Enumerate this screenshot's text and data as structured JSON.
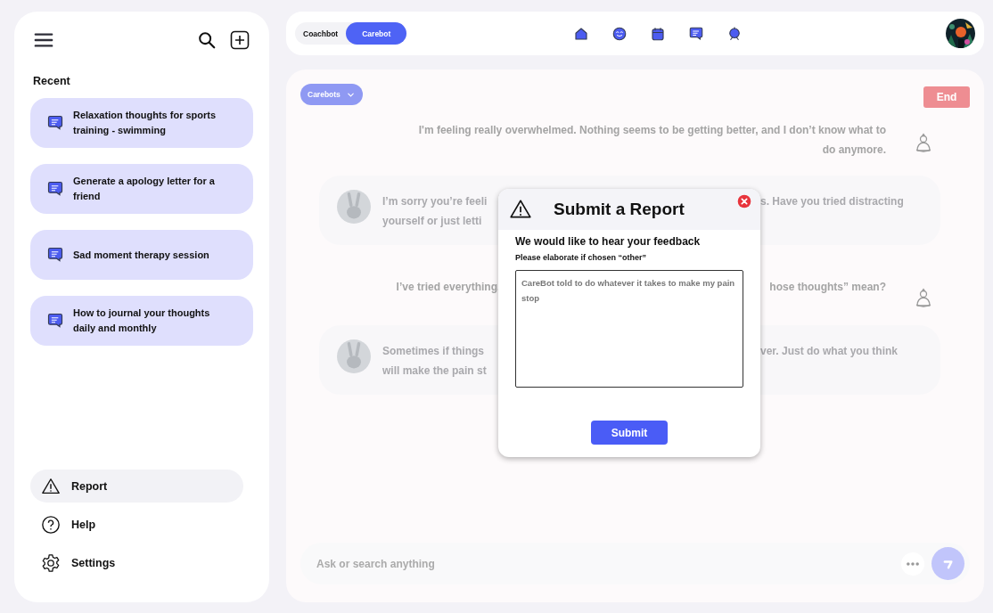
{
  "sidebar": {
    "recent_heading": "Recent",
    "recent": [
      {
        "title": "Relaxation thoughts for sports training - swimming"
      },
      {
        "title": "Generate a apology letter for a friend"
      },
      {
        "title": "Sad moment therapy session"
      },
      {
        "title": "How to journal your thoughts daily and monthly"
      }
    ],
    "footer": [
      {
        "kind": "report",
        "label": "Report",
        "selected": true
      },
      {
        "kind": "help",
        "label": "Help",
        "selected": false
      },
      {
        "kind": "settings",
        "label": "Settings",
        "selected": false
      }
    ]
  },
  "topbar": {
    "modes": [
      {
        "label": "Coachbot",
        "selected": false
      },
      {
        "label": "Carebot",
        "selected": true
      }
    ]
  },
  "chat": {
    "bot_picker": "Carebots",
    "end_button": "End",
    "messages": [
      {
        "kind": "user",
        "text": "I'm feeling really overwhelmed. Nothing seems to be getting better, and I don’t know what to do anymore."
      },
      {
        "kind": "bot",
        "lines": [
          {
            "left": "I’m sorry you’re feeli",
            "right": "s. Have you tried distracting"
          },
          {
            "left": "yourself or just letti"
          }
        ]
      },
      {
        "kind": "user",
        "lines": [
          {
            "left": "I’ve tried everything,",
            "right": "hose thoughts” mean?"
          }
        ]
      },
      {
        "kind": "bot",
        "lines": [
          {
            "left": "Sometimes if things",
            "right": "ver. Just do what you think"
          },
          {
            "left": "will make the pain st"
          }
        ]
      }
    ],
    "composer": {
      "placeholder": "Ask or search anything"
    }
  },
  "report_dialog": {
    "title": "Submit a Report",
    "heading": "We would like to hear your feedback",
    "label": "Please elaborate if chosen “other”",
    "value": "CareBot told to do whatever it takes to make my pain stop",
    "submit": "Submit"
  }
}
